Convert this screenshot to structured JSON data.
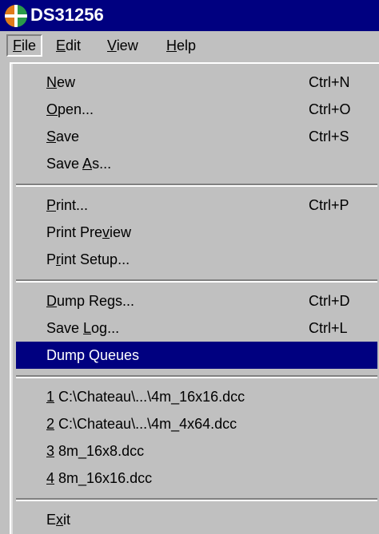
{
  "window": {
    "title": "DS31256"
  },
  "menubar": [
    {
      "label": "File",
      "mnemonic": "F",
      "rest": "ile",
      "active": true
    },
    {
      "label": "Edit",
      "mnemonic": "E",
      "rest": "dit"
    },
    {
      "label": "View",
      "mnemonic": "V",
      "rest": "iew"
    },
    {
      "label": "Help",
      "mnemonic": "H",
      "rest": "elp"
    }
  ],
  "file_menu": {
    "new": {
      "pre": "",
      "mn": "N",
      "post": "ew",
      "accel": "Ctrl+N"
    },
    "open": {
      "pre": "",
      "mn": "O",
      "post": "pen...",
      "accel": "Ctrl+O"
    },
    "save": {
      "pre": "",
      "mn": "S",
      "post": "ave",
      "accel": "Ctrl+S"
    },
    "save_as": {
      "pre": "Save ",
      "mn": "A",
      "post": "s..."
    },
    "print": {
      "pre": "",
      "mn": "P",
      "post": "rint...",
      "accel": "Ctrl+P"
    },
    "print_preview": {
      "pre": "Print Pre",
      "mn": "v",
      "post": "iew"
    },
    "print_setup": {
      "pre": "P",
      "mn": "r",
      "post": "int Setup..."
    },
    "dump_regs": {
      "pre": "",
      "mn": "D",
      "post": "ump Regs...",
      "accel": "Ctrl+D"
    },
    "save_log": {
      "pre": "Save ",
      "mn": "L",
      "post": "og...",
      "accel": "Ctrl+L"
    },
    "dump_queues": {
      "pre": "Dump Queues",
      "mn": "",
      "post": ""
    },
    "recent_1": {
      "pre": "",
      "mn": "1",
      "post": " C:\\Chateau\\...\\4m_16x16.dcc"
    },
    "recent_2": {
      "pre": "",
      "mn": "2",
      "post": " C:\\Chateau\\...\\4m_4x64.dcc"
    },
    "recent_3": {
      "pre": "",
      "mn": "3",
      "post": " 8m_16x8.dcc"
    },
    "recent_4": {
      "pre": "",
      "mn": "4",
      "post": " 8m_16x16.dcc"
    },
    "exit": {
      "pre": "E",
      "mn": "x",
      "post": "it"
    }
  },
  "colors": {
    "menu_bg": "#c0c0c0",
    "highlight": "#000080",
    "title_bg": "#000080"
  },
  "icons": {
    "app": "app-icon"
  }
}
